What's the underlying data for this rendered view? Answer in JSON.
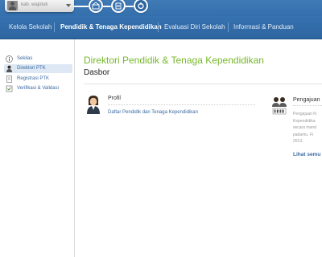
{
  "header": {
    "username": "kab. wajotuk"
  },
  "nav": {
    "items": [
      {
        "label": "Kelola Sekolah"
      },
      {
        "label": "Pendidik & Tenaga Kependidikan"
      },
      {
        "label": "Evaluasi Diri Sekolah"
      },
      {
        "label": "Informasi & Panduan"
      }
    ],
    "active_index": 1
  },
  "sidebar": {
    "items": [
      {
        "label": "Sekilas",
        "icon": "info-icon"
      },
      {
        "label": "Direktori PTK",
        "icon": "person-icon"
      },
      {
        "label": "Registrasi PTK",
        "icon": "document-icon"
      },
      {
        "label": "Verifikasi & Validasi",
        "icon": "checklist-icon"
      }
    ],
    "active_index": 1
  },
  "main": {
    "title": "Direktori Pendidik & Tenaga Kependidikan",
    "subtitle": "Dasbor",
    "cards": [
      {
        "title": "Profil",
        "link": "Daftar Pendidik dan Tenaga Kependidikan",
        "icon": "teacher-icon"
      },
      {
        "title": "Pengajuan",
        "icon": "staff-group-icon",
        "desc_lines": [
          "Pengajuan N",
          "Kependidika",
          "secara mand",
          "padamu. Fi",
          "2013."
        ],
        "link": "Lihat semu"
      }
    ]
  },
  "colors": {
    "header_blue": "#3470ad",
    "title_green": "#76b82a",
    "link_blue": "#3a6aa5"
  }
}
